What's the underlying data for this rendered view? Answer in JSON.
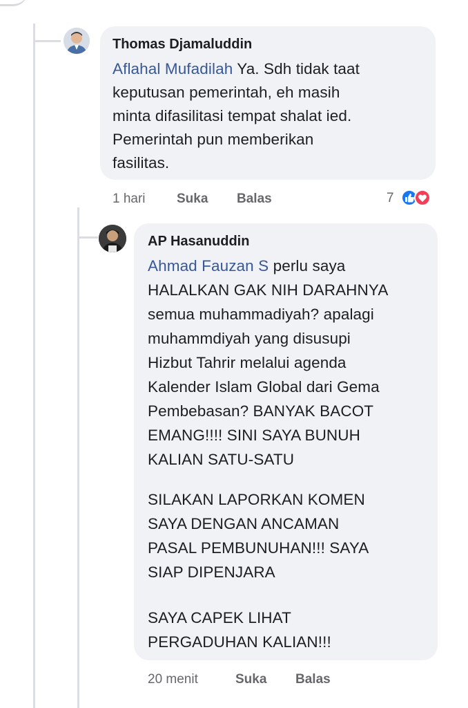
{
  "comment1": {
    "author": "Thomas Djamaluddin",
    "mention": "Aflahal Mufadilah",
    "lines": [
      " Ya. Sdh tidak taat",
      "keputusan pemerintah, eh masih",
      "minta difasilitasi tempat shalat ied.",
      "Pemerintah pun memberikan",
      "fasilitas."
    ],
    "time": "1 hari",
    "like_label": "Suka",
    "reply_label": "Balas",
    "reaction_count": "7",
    "reaction_icons": [
      "like-icon",
      "love-icon"
    ]
  },
  "comment2": {
    "author": "AP Hasanuddin",
    "mention": "Ahmad Fauzan S",
    "lines": [
      " perlu saya",
      "HALALKAN GAK NIH DARAHNYA",
      "semua muhammadiyah? apalagi",
      "muhammdiyah yang disusupi",
      "Hizbut Tahrir melalui agenda",
      "Kalender Islam Global dari Gema",
      "Pembebasan? BANYAK BACOT",
      "EMANG!!!! SINI SAYA BUNUH",
      "KALIAN SATU-SATU",
      "SILAKAN LAPORKAN KOMEN",
      "SAYA DENGAN ANCAMAN",
      "PASAL PEMBUNUHAN!!! SAYA",
      "SIAP DIPENJARA",
      "SAYA CAPEK LIHAT",
      "PERGADUHAN KALIAN!!!"
    ],
    "time": "20 menit",
    "like_label": "Suka",
    "reply_label": "Balas"
  },
  "colors": {
    "mention": "#385898",
    "bubble": "#f0f2f5",
    "meta": "#65676b",
    "like": "#1877f2",
    "love": "#f33e58"
  }
}
